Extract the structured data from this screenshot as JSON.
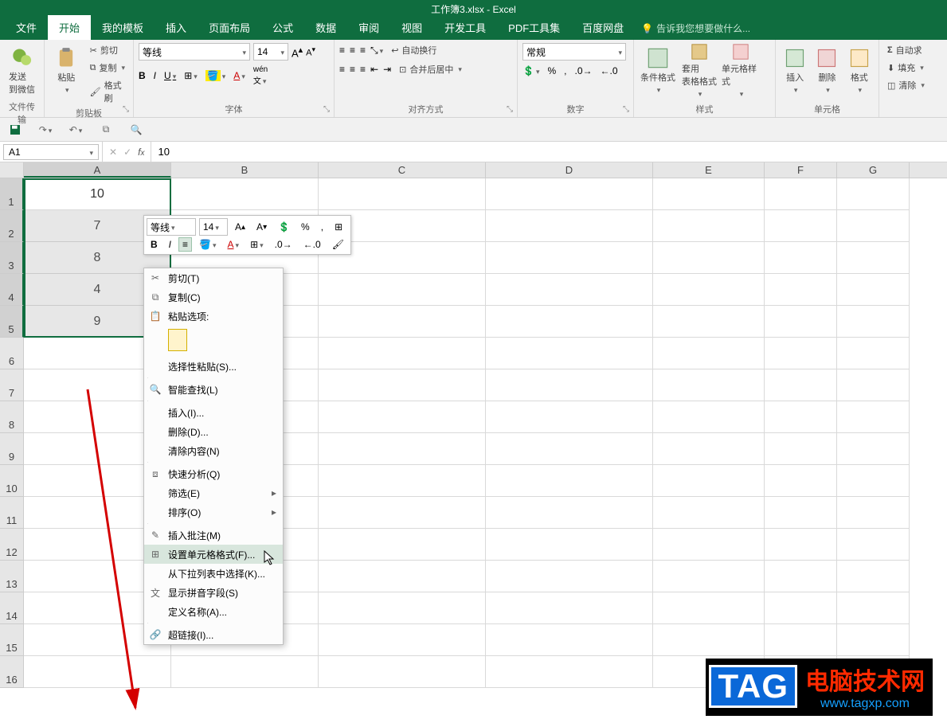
{
  "title": "工作簿3.xlsx - Excel",
  "tabs": [
    "文件",
    "开始",
    "我的模板",
    "插入",
    "页面布局",
    "公式",
    "数据",
    "审阅",
    "视图",
    "开发工具",
    "PDF工具集",
    "百度网盘"
  ],
  "active_tab": 1,
  "tell_me": "告诉我您想要做什么...",
  "ribbon": {
    "clipboard": {
      "wechat": "发送\n到微信",
      "transfer": "文件传输",
      "paste": "粘贴",
      "cut": "剪切",
      "copy": "复制",
      "format_painter": "格式刷",
      "group": "剪贴板"
    },
    "font": {
      "name": "等线",
      "size": "14",
      "bold": "B",
      "italic": "I",
      "underline": "U",
      "group": "字体"
    },
    "align": {
      "wrap": "自动换行",
      "merge": "合并后居中",
      "group": "对齐方式"
    },
    "number": {
      "format": "常规",
      "group": "数字"
    },
    "styles": {
      "cond": "条件格式",
      "table": "套用\n表格格式",
      "cell": "单元格样式",
      "group": "样式"
    },
    "cells": {
      "insert": "插入",
      "delete": "删除",
      "format": "格式",
      "group": "单元格"
    },
    "editing": {
      "autosum": "自动求",
      "fill": "填充",
      "clear": "清除"
    }
  },
  "namebox": "A1",
  "formula": "10",
  "columns": [
    "A",
    "B",
    "C",
    "D",
    "E",
    "F",
    "G"
  ],
  "rows": [
    "1",
    "2",
    "3",
    "4",
    "5",
    "6",
    "7",
    "8",
    "9",
    "10",
    "11",
    "12",
    "13",
    "14",
    "15",
    "16"
  ],
  "data": {
    "A": [
      "10",
      "7",
      "8",
      "4",
      "9"
    ]
  },
  "mini_toolbar": {
    "font": "等线",
    "size": "14"
  },
  "context_menu": {
    "items": [
      {
        "key": "cut",
        "label": "剪切(T)",
        "icon": "✂"
      },
      {
        "key": "copy",
        "label": "复制(C)",
        "icon": "⧉"
      },
      {
        "key": "paste_opt",
        "label": "粘贴选项:",
        "icon": "📋",
        "header": true
      },
      {
        "key": "paste_special",
        "label": "选择性粘贴(S)..."
      },
      {
        "key": "smart",
        "label": "智能查找(L)",
        "icon": "🔍",
        "sep_before": true
      },
      {
        "key": "insert",
        "label": "插入(I)...",
        "sep_before": true
      },
      {
        "key": "delete",
        "label": "删除(D)..."
      },
      {
        "key": "clear",
        "label": "清除内容(N)"
      },
      {
        "key": "quick",
        "label": "快速分析(Q)",
        "icon": "⧈",
        "sep_before": true
      },
      {
        "key": "filter",
        "label": "筛选(E)",
        "arrow": true
      },
      {
        "key": "sort",
        "label": "排序(O)",
        "arrow": true
      },
      {
        "key": "comment",
        "label": "插入批注(M)",
        "icon": "✎",
        "sep_before": true
      },
      {
        "key": "format_cells",
        "label": "设置单元格格式(F)...",
        "icon": "⊞",
        "hov": true
      },
      {
        "key": "dropdown",
        "label": "从下拉列表中选择(K)..."
      },
      {
        "key": "pinyin",
        "label": "显示拼音字段(S)",
        "icon": "文"
      },
      {
        "key": "name",
        "label": "定义名称(A)..."
      },
      {
        "key": "hyperlink",
        "label": "超链接(I)...",
        "icon": "🔗",
        "sep_before": true
      }
    ]
  },
  "watermark": {
    "tag": "TAG",
    "text": "电脑技术网",
    "url": "www.tagxp.com"
  }
}
